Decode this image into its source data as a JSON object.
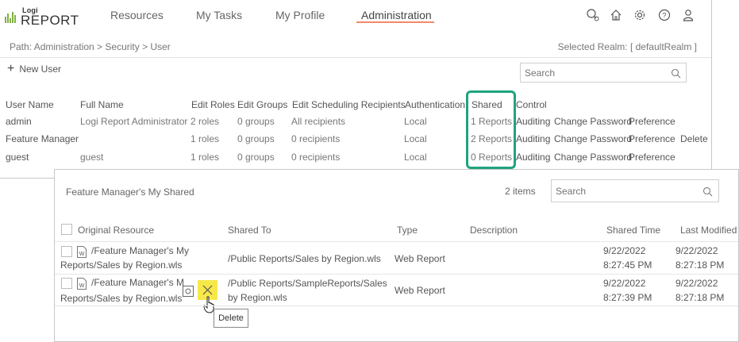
{
  "app": {
    "logo_top": "Logi",
    "logo_main": "REPORT"
  },
  "nav": {
    "items": [
      "Resources",
      "My Tasks",
      "My Profile",
      "Administration"
    ],
    "active": "Administration"
  },
  "top_icons": [
    "search-settings-icon",
    "home-icon",
    "gear-icon",
    "help-icon",
    "user-icon"
  ],
  "breadcrumb": "Path: Administration > Security > User",
  "realm": "Selected Realm: [ defaultRealm ]",
  "toolbar": {
    "new_user": "New User",
    "search_placeholder": "Search"
  },
  "user_table": {
    "headers": [
      "User Name",
      "Full Name",
      "Edit Roles",
      "Edit Groups",
      "Edit Scheduling Recipients",
      "Authentication",
      "Shared",
      "Control"
    ],
    "rows": [
      {
        "user": "admin",
        "full": "Logi Report Administrator",
        "roles": "2 roles",
        "groups": "0 groups",
        "recipients": "All recipients",
        "auth": "Local",
        "shared": "1 Reports",
        "auditing": "Auditing",
        "change_pw": "Change Password",
        "pref": "Preference",
        "delete": ""
      },
      {
        "user": "Feature Manager",
        "full": "",
        "roles": "1 roles",
        "groups": "0 groups",
        "recipients": "0 recipients",
        "auth": "Local",
        "shared": "2 Reports",
        "auditing": "Auditing",
        "change_pw": "Change Password",
        "pref": "Preference",
        "delete": "Delete"
      },
      {
        "user": "guest",
        "full": "guest",
        "roles": "1 roles",
        "groups": "0 groups",
        "recipients": "0 recipients",
        "auth": "Local",
        "shared": "0 Reports",
        "auditing": "Auditing",
        "change_pw": "Change Password",
        "pref": "Preference",
        "delete": ""
      }
    ]
  },
  "popup": {
    "title": "Feature Manager's My Shared",
    "count": "2 items",
    "search_placeholder": "Search",
    "headers": [
      "Original Resource",
      "Shared To",
      "Type",
      "Description",
      "Shared Time",
      "Last Modified"
    ],
    "rows": [
      {
        "resource_line1": "/Feature Manager's My",
        "resource_line2": "Reports/Sales by Region.wls",
        "shared_to_line1": "/Public Reports/Sales by Region.wls",
        "shared_to_line2": "",
        "type": "Web Report",
        "description": "",
        "shared_date": "9/22/2022",
        "shared_time": "8:27:45 PM",
        "mod_date": "9/22/2022",
        "mod_time": "8:27:18 PM"
      },
      {
        "resource_line1": "/Feature Manager's M",
        "resource_line2": "Reports/Sales by Region.wls",
        "shared_to_line1": "/Public Reports/SampleReports/Sales",
        "shared_to_line2": "by Region.wls",
        "type": "Web Report",
        "description": "",
        "shared_date": "9/22/2022",
        "shared_time": "8:27:39 PM",
        "mod_date": "9/22/2022",
        "mod_time": "8:27:18 PM"
      }
    ],
    "tooltip": "Delete"
  },
  "colors": {
    "accent_underline": "#f2896b",
    "highlight_border": "#1fa37f",
    "delete_hover": "#f7e84a",
    "logo_green": "#7fb241"
  }
}
